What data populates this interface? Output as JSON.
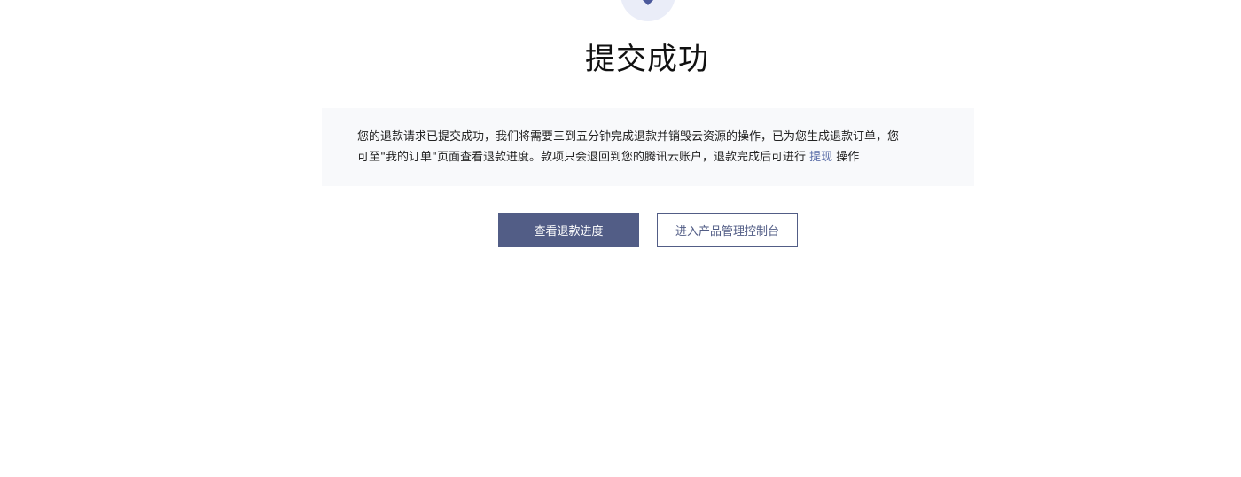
{
  "status": {
    "icon": "check-circle-icon",
    "icon_bg": "#eaedf8",
    "icon_color": "#4c5a9c",
    "title": "提交成功"
  },
  "message": {
    "line1": "您的退款请求已提交成功，我们将需要三到五分钟完成退款并销毁云资源的操作，已为您生成退款订单，您",
    "line2_prefix": "可至\"我的订单\"页面查看退款进度。款项只会退回到您的腾讯云账户，退款完成后可进行",
    "withdraw_link": "提现",
    "line2_suffix": "操作"
  },
  "actions": {
    "view_progress_label": "查看退款进度",
    "console_label": "进入产品管理控制台"
  },
  "colors": {
    "primary": "#525d86",
    "link": "#5b6ea8",
    "panel_bg": "#f8f9fb"
  }
}
